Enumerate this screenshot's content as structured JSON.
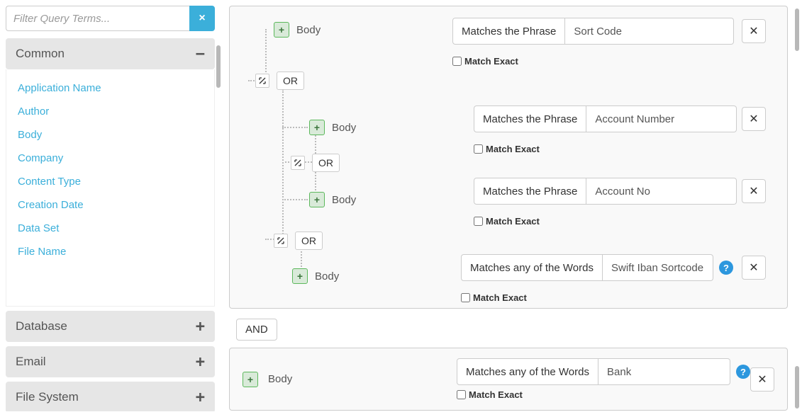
{
  "search": {
    "placeholder": "Filter Query Terms..."
  },
  "accordion": {
    "groups": [
      {
        "label": "Common",
        "expanded": true
      },
      {
        "label": "Database",
        "expanded": false
      },
      {
        "label": "Email",
        "expanded": false
      },
      {
        "label": "File System",
        "expanded": false
      }
    ],
    "common_terms": [
      "Application Name",
      "Author",
      "Body",
      "Company",
      "Content Type",
      "Creation Date",
      "Data Set",
      "File Name"
    ]
  },
  "labels": {
    "body": "Body",
    "or": "OR",
    "and": "AND",
    "match_exact": "Match Exact",
    "matches_phrase": "Matches the Phrase",
    "matches_any": "Matches any of the Words"
  },
  "values": {
    "sort_code": "Sort Code",
    "account_number": "Account Number",
    "account_no": "Account No",
    "swift": "Swift Iban Sortcode",
    "bank": "Bank"
  }
}
